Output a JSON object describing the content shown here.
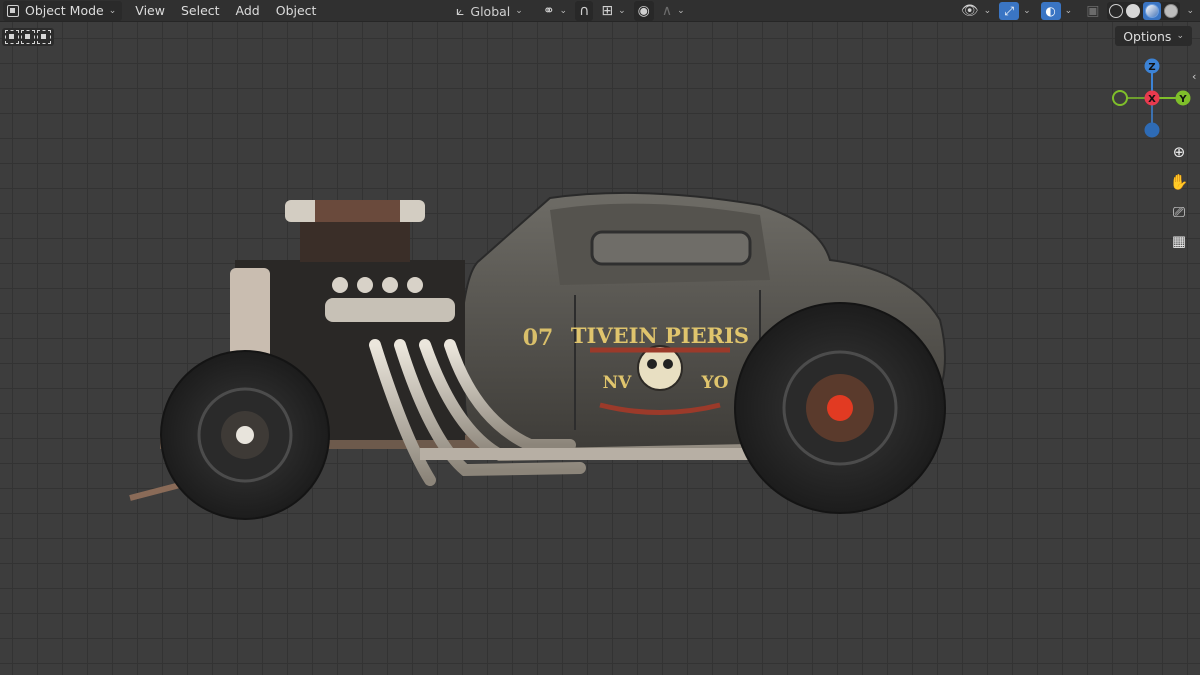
{
  "header": {
    "mode": "Object Mode",
    "menus": [
      "View",
      "Select",
      "Add",
      "Object"
    ],
    "transform_orientation": "Global"
  },
  "viewport": {
    "options_label": "Options"
  },
  "gizmo": {
    "z_label": "Z",
    "x_label": "X",
    "y_label": "Y"
  },
  "car": {
    "number": "07",
    "door_text": "TIVEIN PIERIS",
    "door_text_left": "NV",
    "door_text_right": "YO"
  },
  "colors": {
    "accent": "#3a75c4",
    "axis_x": "#e83a4e",
    "axis_y": "#7fbf2a",
    "axis_z": "#3c83d6"
  },
  "icons": {
    "mode": "object-mode-icon",
    "orientation": "transform-orientation-icon",
    "pivot": "pivot-icon",
    "snap": "snap-icon",
    "proportional": "proportional-editing-icon",
    "visibility": "eye-visibility-icon",
    "gizmo_toggle": "gizmo-toggle-icon",
    "overlays": "overlays-icon",
    "xray": "xray-icon",
    "zoom": "zoom-icon",
    "pan": "hand-pan-icon",
    "camera": "camera-view-icon",
    "grid": "grid-ortho-icon"
  }
}
